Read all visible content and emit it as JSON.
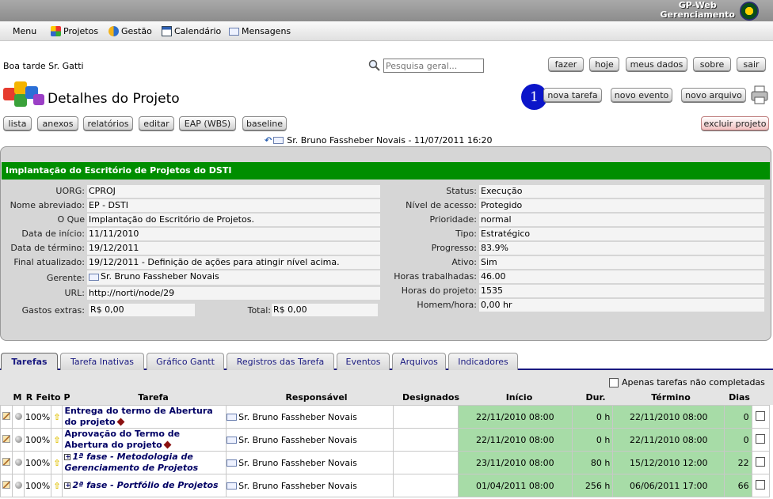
{
  "brand": {
    "line1": "GP-Web",
    "line2": "Gerenciamento"
  },
  "menu": {
    "main": "Menu",
    "items": [
      {
        "label": "Projetos",
        "icon": "puzzle-icon"
      },
      {
        "label": "Gestão",
        "icon": "gear-circle-icon"
      },
      {
        "label": "Calendário",
        "icon": "calendar-icon"
      },
      {
        "label": "Mensagens",
        "icon": "envelope-icon"
      }
    ]
  },
  "greeting": "Boa tarde Sr. Gatti",
  "search": {
    "placeholder": "Pesquisa geral..."
  },
  "top_buttons": [
    "fazer",
    "hoje",
    "meus dados",
    "sobre",
    "sair"
  ],
  "page_title": "Detalhes do Projeto",
  "badge_number": "1",
  "action_buttons": [
    "nova tarefa",
    "novo evento",
    "novo arquivo"
  ],
  "nav_buttons": [
    "lista",
    "anexos",
    "relatórios",
    "editar",
    "EAP (WBS)",
    "baseline"
  ],
  "delete_button": "excluir projeto",
  "owner_line": "Sr. Bruno Fassheber Novais - 11/07/2011 16:20",
  "project": {
    "title": "Implantação do Escritório de Projetos do DSTI",
    "left_fields": [
      {
        "label": "UORG:",
        "value": "CPROJ"
      },
      {
        "label": "Nome abreviado:",
        "value": "EP - DSTI"
      },
      {
        "label": "O Que",
        "value": "Implantação do Escritório de Projetos."
      },
      {
        "label": "Data de início:",
        "value": "11/11/2010"
      },
      {
        "label": "Data de término:",
        "value": "19/12/2011"
      },
      {
        "label": "Final atualizado:",
        "value": "19/12/2011 - Definição de ações para atingir nível acima."
      },
      {
        "label": "Gerente:",
        "value": "Sr. Bruno Fassheber Novais"
      },
      {
        "label": "URL:",
        "value": "http://norti/node/29"
      }
    ],
    "gastos_label": "Gastos extras:",
    "gastos_value": "R$ 0,00",
    "total_label": "Total:",
    "total_value": "R$ 0,00",
    "right_fields": [
      {
        "label": "Status:",
        "value": "Execução"
      },
      {
        "label": "Nível de acesso:",
        "value": "Protegido"
      },
      {
        "label": "Prioridade:",
        "value": "normal"
      },
      {
        "label": "Tipo:",
        "value": "Estratégico"
      },
      {
        "label": "Progresso:",
        "value": "83.9%"
      },
      {
        "label": "Ativo:",
        "value": "Sim"
      },
      {
        "label": "Horas trabalhadas:",
        "value": "46.00"
      },
      {
        "label": "Horas do projeto:",
        "value": "1535"
      },
      {
        "label": "Homem/hora:",
        "value": "0,00 hr"
      }
    ]
  },
  "tabs": [
    "Tarefas",
    "Tarefa Inativas",
    "Gráfico Gantt",
    "Registros das Tarefa",
    "Eventos",
    "Arquivos",
    "Indicadores"
  ],
  "only_incomplete": "Apenas tarefas não completadas",
  "table": {
    "headers": [
      "M",
      "R",
      "Feito",
      "P",
      "Tarefa",
      "Responsável",
      "Designados",
      "Início",
      "Dur.",
      "Término",
      "Dias"
    ],
    "rows": [
      {
        "feito": "100%",
        "tarefa": "Entrega do termo de Abertura do projeto",
        "responsavel": "Sr. Bruno Fassheber Novais",
        "inicio": "22/11/2010 08:00",
        "dur": "0 h",
        "termino": "22/11/2010 08:00",
        "dias": "0"
      },
      {
        "feito": "100%",
        "tarefa": "Aprovação do Termo de Abertura do projeto",
        "responsavel": "Sr. Bruno Fassheber Novais",
        "inicio": "22/11/2010 08:00",
        "dur": "0 h",
        "termino": "22/11/2010 08:00",
        "dias": "0"
      },
      {
        "feito": "100%",
        "tarefa": "1ª fase - Metodologia de Gerenciamento de Projetos",
        "responsavel": "Sr. Bruno Fassheber Novais",
        "inicio": "23/11/2010 08:00",
        "dur": "80 h",
        "termino": "15/12/2010 12:00",
        "dias": "22"
      },
      {
        "feito": "100%",
        "tarefa": "2ª fase - Portfólio de Projetos",
        "responsavel": "Sr. Bruno Fassheber Novais",
        "inicio": "01/04/2011 08:00",
        "dur": "256 h",
        "termino": "06/06/2011 17:00",
        "dias": "66"
      }
    ]
  }
}
